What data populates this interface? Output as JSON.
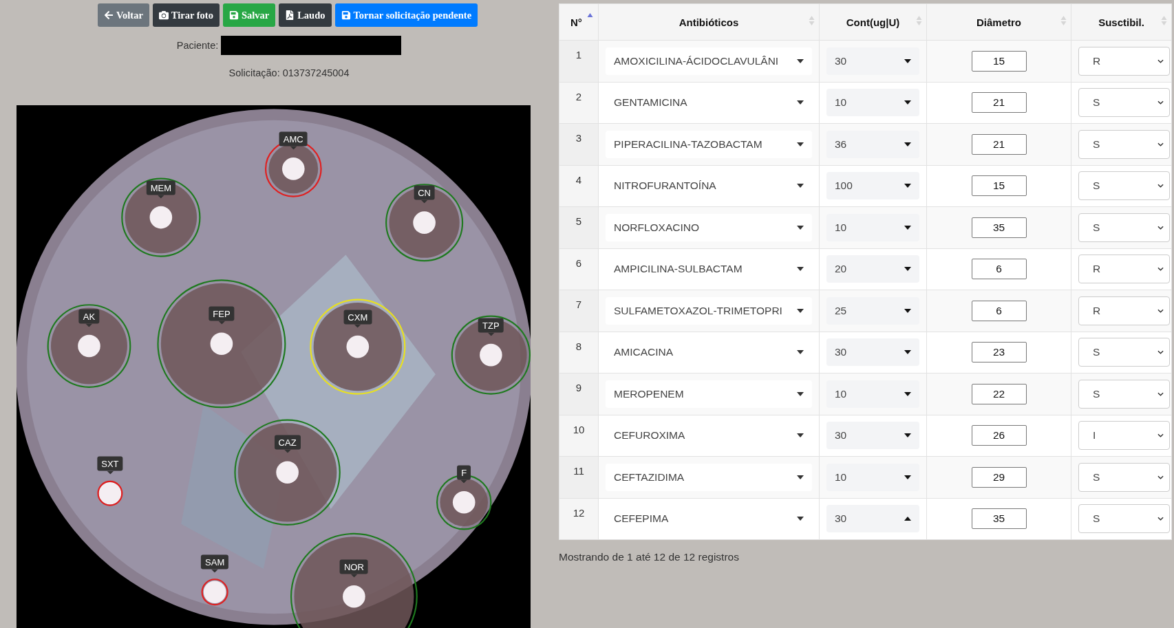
{
  "toolbar": [
    {
      "kind": "back",
      "label": "Voltar"
    },
    {
      "kind": "camera",
      "label": "Tirar foto"
    },
    {
      "kind": "save",
      "label": "Salvar"
    },
    {
      "kind": "pdf",
      "label": "Laudo"
    },
    {
      "kind": "pending",
      "label": "Tornar solicitação pendente"
    }
  ],
  "patient": {
    "label": "Paciente:"
  },
  "request": {
    "text": "Solicitação: 013737245004"
  },
  "plate": {
    "kind": "picture",
    "zones": [
      {
        "label": "AMC",
        "color": "#e01f1f"
      },
      {
        "label": "MEM",
        "color": "#1f7a1f"
      },
      {
        "label": "CN",
        "color": "#1f7a1f"
      },
      {
        "label": "AK",
        "color": "#1f7a1f"
      },
      {
        "label": "FEP",
        "color": "#1f7a1f"
      },
      {
        "label": "CXM",
        "color": "#e8e020"
      },
      {
        "label": "TZP",
        "color": "#1f7a1f"
      },
      {
        "label": "CAZ",
        "color": "#1f7a1f"
      },
      {
        "label": "SXT",
        "color": "#e01f1f"
      },
      {
        "label": "F",
        "color": "#1f7a1f"
      },
      {
        "label": "SAM",
        "color": "#e01f1f"
      },
      {
        "label": "NOR",
        "color": "#1f7a1f"
      }
    ]
  },
  "table": {
    "columns": [
      {
        "label": "N°",
        "sorted": true
      },
      {
        "label": "Antibióticos",
        "sorted": false
      },
      {
        "label": "Cont(ug|U)",
        "sorted": false
      },
      {
        "label": "Diâmetro",
        "sorted": false
      },
      {
        "label": "Susctibil.",
        "sorted": false
      }
    ],
    "rows": [
      {
        "n": "1",
        "antibiotic": "AMOXICILINA-ÁCIDOCLAVULÂNI",
        "content": "30",
        "content_open": false,
        "diameter": "15",
        "susceptibility": "R"
      },
      {
        "n": "2",
        "antibiotic": "GENTAMICINA",
        "content": "10",
        "content_open": false,
        "diameter": "21",
        "susceptibility": "S"
      },
      {
        "n": "3",
        "antibiotic": "PIPERACILINA-TAZOBACTAM",
        "content": "36",
        "content_open": false,
        "diameter": "21",
        "susceptibility": "S"
      },
      {
        "n": "4",
        "antibiotic": "NITROFURANTOÍNA",
        "content": "100",
        "content_open": false,
        "diameter": "15",
        "susceptibility": "S"
      },
      {
        "n": "5",
        "antibiotic": "NORFLOXACINO",
        "content": "10",
        "content_open": false,
        "diameter": "35",
        "susceptibility": "S"
      },
      {
        "n": "6",
        "antibiotic": "AMPICILINA-SULBACTAM",
        "content": "20",
        "content_open": false,
        "diameter": "6",
        "susceptibility": "R"
      },
      {
        "n": "7",
        "antibiotic": "SULFAMETOXAZOL-TRIMETOPRI",
        "content": "25",
        "content_open": false,
        "diameter": "6",
        "susceptibility": "R"
      },
      {
        "n": "8",
        "antibiotic": "AMICACINA",
        "content": "30",
        "content_open": false,
        "diameter": "23",
        "susceptibility": "S"
      },
      {
        "n": "9",
        "antibiotic": "MEROPENEM",
        "content": "10",
        "content_open": false,
        "diameter": "22",
        "susceptibility": "S"
      },
      {
        "n": "10",
        "antibiotic": "CEFUROXIMA",
        "content": "30",
        "content_open": false,
        "diameter": "26",
        "susceptibility": "I"
      },
      {
        "n": "11",
        "antibiotic": "CEFTAZIDIMA",
        "content": "10",
        "content_open": false,
        "diameter": "29",
        "susceptibility": "S"
      },
      {
        "n": "12",
        "antibiotic": "CEFEPIMA",
        "content": "30",
        "content_open": true,
        "diameter": "35",
        "susceptibility": "S"
      }
    ]
  },
  "footer": "Mostrando de 1 até 12 de 12 registros"
}
